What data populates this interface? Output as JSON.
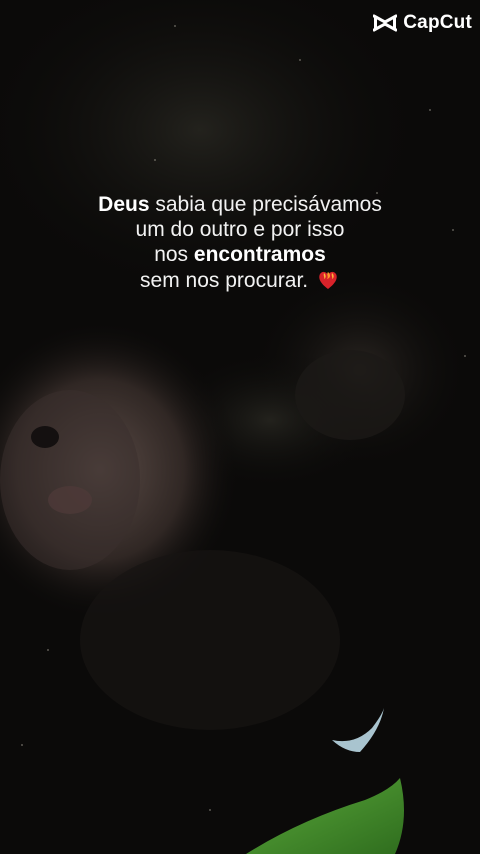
{
  "watermark": {
    "brand": "CapCut",
    "icon": "capcut-logo-icon"
  },
  "caption": {
    "line1_bold": "Deus",
    "line1_rest": " sabia que precisávamos",
    "line2": "um do outro e por isso",
    "line3_start": "nos ",
    "line3_bold": "encontramos",
    "line4": "sem nos procurar. ",
    "emoji_icon": "heart-on-fire-icon"
  },
  "colors": {
    "background": "#0b0a09",
    "text": "#f2f2f2",
    "accent_green": "#3f8f2a"
  }
}
